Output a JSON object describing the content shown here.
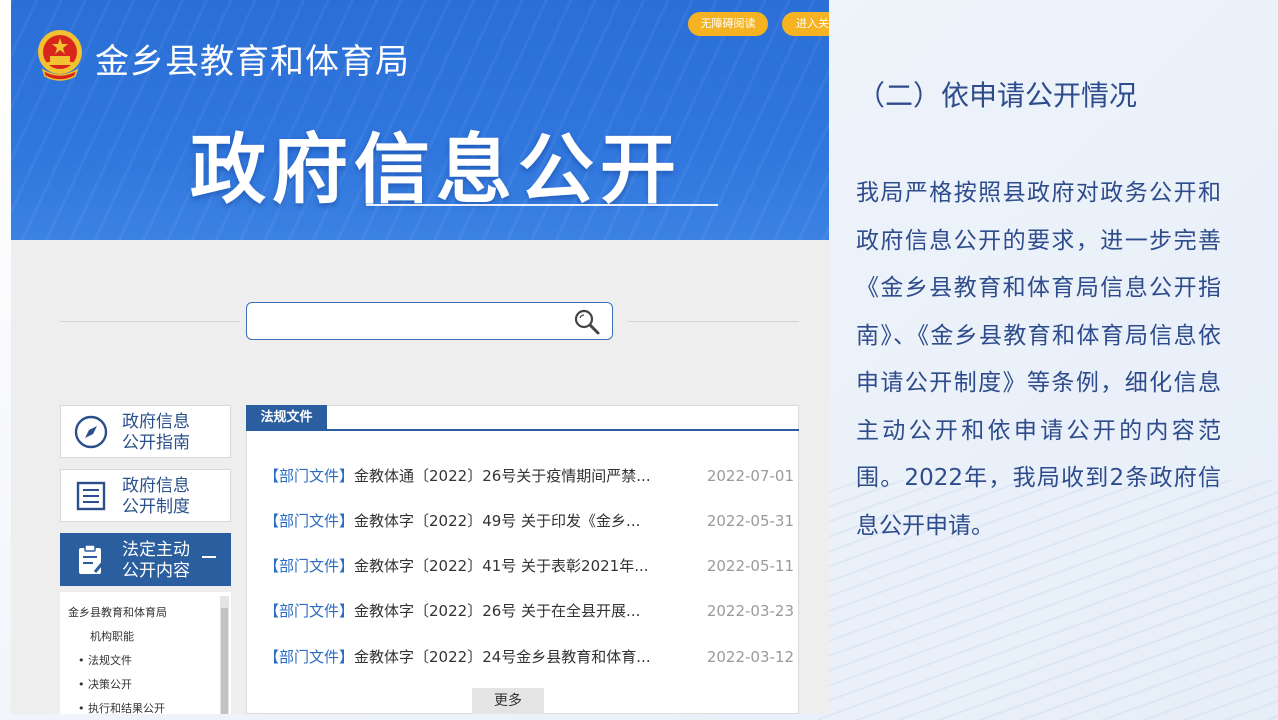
{
  "slide": {
    "heading": "（二）依申请公开情况",
    "body": "我局严格按照县政府对政务公开和政府信息公开的要求，进一步完善《金乡县教育和体育局信息公开指南》、《金乡县教育和体育局信息依申请公开制度》等条例，细化信息主动公开和依申请公开的内容范围。2022年，我局收到2条政府信息公开申请。"
  },
  "website": {
    "site_title": "金乡县教育和体育局",
    "accessibility_label": "无障碍阅读",
    "enter_label": "进入关",
    "banner_title": "政府信息公开",
    "search": {
      "placeholder": ""
    },
    "sidebar": [
      {
        "label": "政府信息\n公开指南",
        "icon": "compass-icon"
      },
      {
        "label": "政府信息\n公开制度",
        "icon": "list-icon"
      },
      {
        "label": "法定主动\n公开内容",
        "icon": "document-edit-icon"
      }
    ],
    "tree": {
      "root": "金乡县教育和体育局",
      "items": [
        "机构职能",
        "法规文件",
        "决策公开",
        "执行和结果公开"
      ]
    },
    "laws": {
      "tab_label": "法规文件",
      "rows": [
        {
          "tag": "【部门文件】",
          "title": "金教体通〔2022〕26号关于疫情期间严禁...",
          "date": "2022-07-01"
        },
        {
          "tag": "【部门文件】",
          "title": "金教体字〔2022〕49号 关于印发《金乡...",
          "date": "2022-05-31"
        },
        {
          "tag": "【部门文件】",
          "title": "金教体字〔2022〕41号 关于表彰2021年...",
          "date": "2022-05-11"
        },
        {
          "tag": "【部门文件】",
          "title": "金教体字〔2022〕26号 关于在全县开展...",
          "date": "2022-03-23"
        },
        {
          "tag": "【部门文件】",
          "title": "金教体字〔2022〕24号金乡县教育和体育...",
          "date": "2022-03-12"
        }
      ],
      "more_label": "更多"
    },
    "colors": {
      "banner": "#2f76dd",
      "accent_orange": "#f6b321",
      "nav_blue": "#2a5e9e",
      "tag_blue": "#2a6cc3"
    }
  }
}
